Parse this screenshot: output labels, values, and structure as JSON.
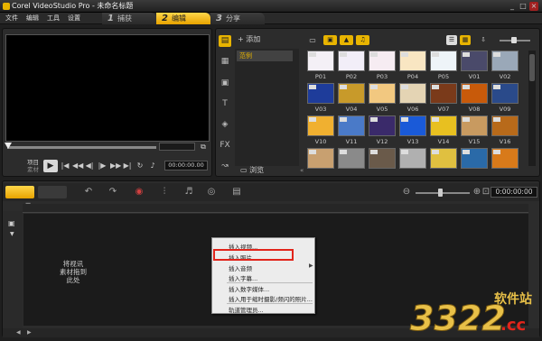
{
  "window": {
    "title": "Corel VideoStudio Pro - 未命名标题",
    "min": "_",
    "max": "□",
    "close": "×"
  },
  "menu": [
    "文件",
    "编辑",
    "工具",
    "设置"
  ],
  "steps": [
    {
      "num": "1",
      "label": "捕获"
    },
    {
      "num": "2",
      "label": "编辑"
    },
    {
      "num": "3",
      "label": "分享"
    }
  ],
  "player": {
    "mode_project": "项目",
    "mode_clip": "素材",
    "timecode": "00:00:00.00",
    "controls": [
      "|◀",
      "◀◀",
      "◀|",
      "|▶",
      "▶▶",
      "▶|",
      "↻"
    ]
  },
  "library": {
    "add_label": "添加",
    "folders": [
      "范例"
    ],
    "browse_label": "浏览",
    "thumbnails": [
      {
        "label": "P01",
        "color": "#f4f0f6"
      },
      {
        "label": "P02",
        "color": "#f2eef8"
      },
      {
        "label": "P03",
        "color": "#f6ecf2"
      },
      {
        "label": "P04",
        "color": "#f9e6c2"
      },
      {
        "label": "P05",
        "color": "#eef4f8"
      },
      {
        "label": "V01",
        "color": "#4a4a6a"
      },
      {
        "label": "V02",
        "color": "#9aa8b8"
      },
      {
        "label": "V03",
        "color": "#1e3c9a"
      },
      {
        "label": "V04",
        "color": "#c89a2a"
      },
      {
        "label": "V05",
        "color": "#f2c880"
      },
      {
        "label": "V06",
        "color": "#e4d4b4"
      },
      {
        "label": "V07",
        "color": "#7a3a1a"
      },
      {
        "label": "V08",
        "color": "#c85a0a"
      },
      {
        "label": "V09",
        "color": "#2a4a8a"
      },
      {
        "label": "V10",
        "color": "#f0b030"
      },
      {
        "label": "V11",
        "color": "#4a7ac8"
      },
      {
        "label": "V12",
        "color": "#3a2a6a"
      },
      {
        "label": "V13",
        "color": "#1a5ad8"
      },
      {
        "label": "V14",
        "color": "#e8c020"
      },
      {
        "label": "V15",
        "color": "#c89a60"
      },
      {
        "label": "V16",
        "color": "#b86a1a"
      },
      {
        "label": "",
        "color": "#c8a070"
      },
      {
        "label": "",
        "color": "#8a8a8a"
      },
      {
        "label": "",
        "color": "#6a5a4a"
      },
      {
        "label": "",
        "color": "#b0b0b0"
      },
      {
        "label": "",
        "color": "#e0c040"
      },
      {
        "label": "",
        "color": "#2a6aa8"
      },
      {
        "label": "",
        "color": "#d87a1a"
      }
    ]
  },
  "timeline": {
    "timecode": "0:00:00:00",
    "drop_hint": "将视讯\n素材拖到\n此处"
  },
  "context_menu": [
    {
      "label": "插入视频...",
      "sub": false
    },
    {
      "label": "插入照片...",
      "sub": false
    },
    {
      "label": "插入音频",
      "sub": true
    },
    {
      "label": "插入字幕...",
      "sub": false
    },
    {
      "label": "插入数字媒体...",
      "sub": false
    },
    {
      "label": "插入用于缩时摄影/频闪的照片...",
      "sub": false
    },
    {
      "label": "轨道管理员...",
      "sub": false
    }
  ],
  "watermark": {
    "number": "3322",
    "cc": ".cc",
    "site": "软件站",
    "accent": "#e1251b",
    "color": "#e8c048"
  }
}
